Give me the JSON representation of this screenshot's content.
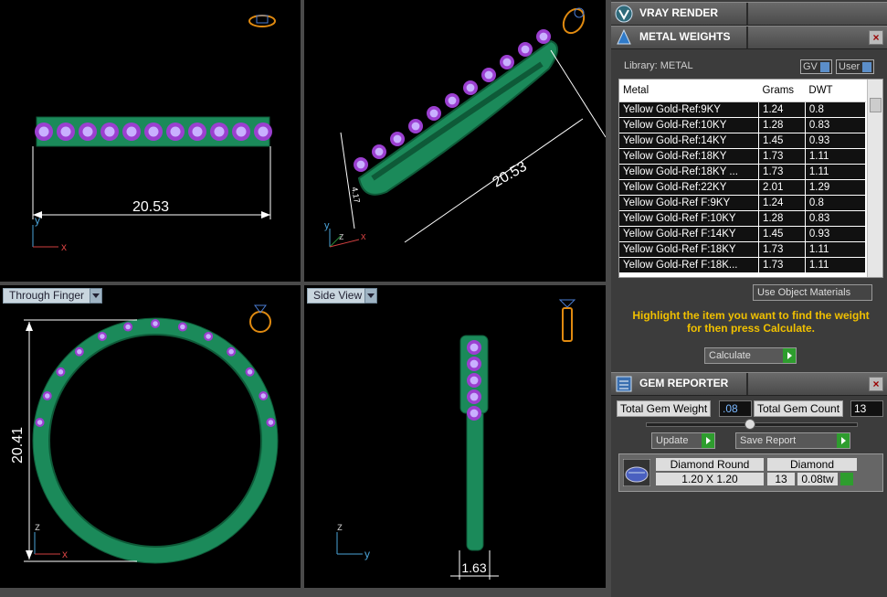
{
  "viewports": {
    "front": {
      "dimension": "20.53"
    },
    "perspective": {
      "dimension": "20.53",
      "dimension_small": "4.17"
    },
    "through_finger": {
      "label": "Through Finger",
      "dimension": "20.41"
    },
    "side_view": {
      "label": "Side View",
      "dimension": "1.63"
    }
  },
  "axes": {
    "x": "x",
    "y": "y",
    "z": "z"
  },
  "panel": {
    "vray": {
      "title": "VRAY RENDER"
    },
    "metal_weights": {
      "title": "METAL WEIGHTS",
      "library": "Library: METAL",
      "gv": "GV",
      "user": "User",
      "columns": [
        "Metal",
        "Grams",
        "DWT"
      ],
      "rows": [
        [
          "Yellow Gold-Ref:9KY",
          "1.24",
          "0.8"
        ],
        [
          "Yellow Gold-Ref:10KY",
          "1.28",
          "0.83"
        ],
        [
          "Yellow Gold-Ref:14KY",
          "1.45",
          "0.93"
        ],
        [
          "Yellow Gold-Ref:18KY",
          "1.73",
          "1.11"
        ],
        [
          "Yellow Gold-Ref:18KY ...",
          "1.73",
          "1.11"
        ],
        [
          "Yellow Gold-Ref:22KY",
          "2.01",
          "1.29"
        ],
        [
          "Yellow Gold-Ref F:9KY",
          "1.24",
          "0.8"
        ],
        [
          "Yellow Gold-Ref F:10KY",
          "1.28",
          "0.83"
        ],
        [
          "Yellow Gold-Ref F:14KY",
          "1.45",
          "0.93"
        ],
        [
          "Yellow Gold-Ref F:18KY",
          "1.73",
          "1.11"
        ],
        [
          "Yellow Gold-Ref F:18K...",
          "1.73",
          "1.11"
        ]
      ],
      "use_object_materials": "Use Object Materials",
      "hint": "Highlight the item you want to find the weight for then press Calculate.",
      "calculate": "Calculate"
    },
    "gem_reporter": {
      "title": "GEM REPORTER",
      "total_gem_weight_label": "Total Gem Weight",
      "total_gem_weight": ".08",
      "total_gem_count_label": "Total Gem Count",
      "total_gem_count": "13",
      "update": "Update",
      "save_report": "Save Report",
      "gem": {
        "name": "Diamond Round",
        "size": "1.20 X 1.20",
        "material": "Diamond",
        "count": "13",
        "weight": "0.08tw"
      }
    }
  },
  "colors": {
    "ring": "#1b8a5a",
    "ring_dark": "#0e5a38",
    "gem": "#9b3fd0",
    "gem_light": "#c9b0ff",
    "hint": "#f0c000"
  }
}
